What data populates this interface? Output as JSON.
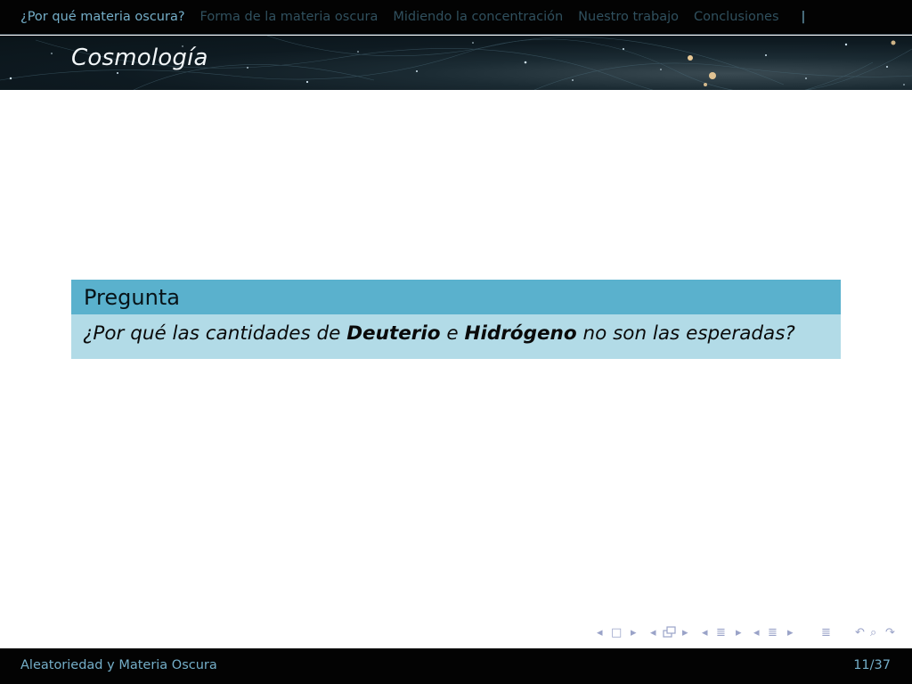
{
  "nav": {
    "sections": [
      {
        "label": "¿Por qué materia oscura?",
        "active": true
      },
      {
        "label": "Forma de la materia oscura",
        "active": false
      },
      {
        "label": "Midiendo la concentración",
        "active": false
      },
      {
        "label": "Nuestro trabajo",
        "active": false
      },
      {
        "label": "Conclusiones",
        "active": false
      }
    ],
    "separator": "|"
  },
  "frame": {
    "title": "Cosmología"
  },
  "block": {
    "title": "Pregunta",
    "body_pre": "¿Por qué las cantidades de ",
    "body_bold1": "Deuterio",
    "body_mid": " e ",
    "body_bold2": "Hidrógeno",
    "body_post": " no son las esperadas?"
  },
  "navsymbols": {
    "left": "◂",
    "frame": "□",
    "right": "▸",
    "subsection": "≣",
    "section": "≣",
    "align": "≣",
    "undo": "↶",
    "search": "⌕",
    "redo": "↷"
  },
  "footer": {
    "title": "Aleatoriedad y Materia Oscura",
    "page": "11/37"
  },
  "colors": {
    "nav_active": "#74aec8",
    "nav_inactive": "#30505e",
    "block_head": "#5ab1cd",
    "block_body": "#b2dbe7"
  }
}
